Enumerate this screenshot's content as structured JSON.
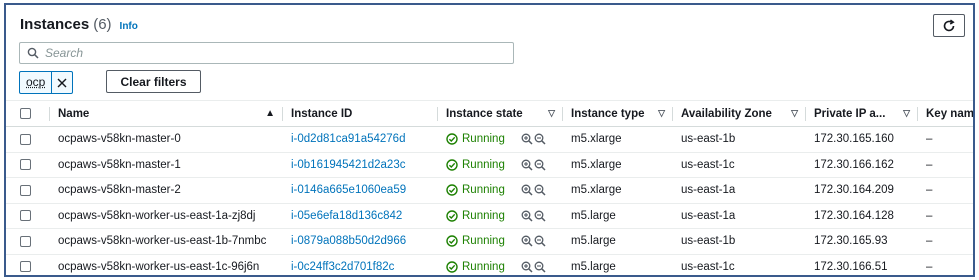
{
  "header": {
    "title": "Instances",
    "count": "(6)",
    "info": "Info"
  },
  "search": {
    "placeholder": "Search"
  },
  "filter_token": {
    "label": "ocp"
  },
  "clear_filters": "Clear filters",
  "columns": [
    {
      "label": "Name",
      "sort": "ascending"
    },
    {
      "label": "Instance ID"
    },
    {
      "label": "Instance state"
    },
    {
      "label": "Instance type"
    },
    {
      "label": "Availability Zone"
    },
    {
      "label": "Private IP a..."
    },
    {
      "label": "Key name"
    }
  ],
  "rows": [
    {
      "name": "ocpaws-v58kn-master-0",
      "id": "i-0d2d81ca91a54276d",
      "state": "Running",
      "type": "m5.xlarge",
      "az": "us-east-1b",
      "ip": "172.30.165.160",
      "key": "–"
    },
    {
      "name": "ocpaws-v58kn-master-1",
      "id": "i-0b161945421d2a23c",
      "state": "Running",
      "type": "m5.xlarge",
      "az": "us-east-1c",
      "ip": "172.30.166.162",
      "key": "–"
    },
    {
      "name": "ocpaws-v58kn-master-2",
      "id": "i-0146a665e1060ea59",
      "state": "Running",
      "type": "m5.xlarge",
      "az": "us-east-1a",
      "ip": "172.30.164.209",
      "key": "–"
    },
    {
      "name": "ocpaws-v58kn-worker-us-east-1a-zj8dj",
      "id": "i-05e6efa18d136c842",
      "state": "Running",
      "type": "m5.large",
      "az": "us-east-1a",
      "ip": "172.30.164.128",
      "key": "–"
    },
    {
      "name": "ocpaws-v58kn-worker-us-east-1b-7nmbc",
      "id": "i-0879a088b50d2d966",
      "state": "Running",
      "type": "m5.large",
      "az": "us-east-1b",
      "ip": "172.30.165.93",
      "key": "–"
    },
    {
      "name": "ocpaws-v58kn-worker-us-east-1c-96j6n",
      "id": "i-0c24ff3c2d701f82c",
      "state": "Running",
      "type": "m5.large",
      "az": "us-east-1c",
      "ip": "172.30.166.51",
      "key": "–"
    }
  ],
  "colors": {
    "link": "#0073bb",
    "running": "#1d8102",
    "frame": "#3a5a8c"
  }
}
